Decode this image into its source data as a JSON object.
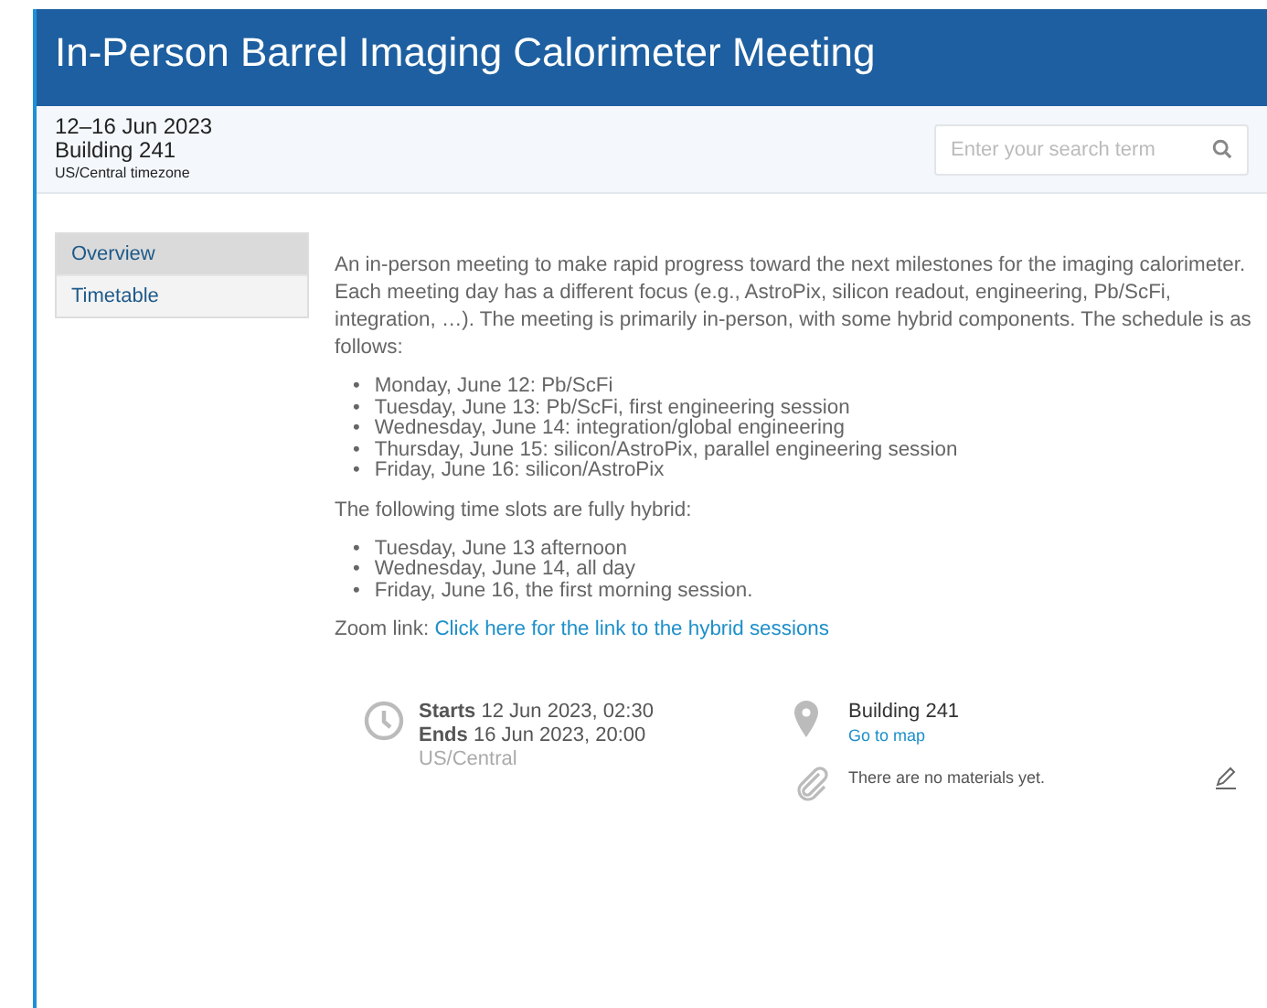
{
  "title": "In-Person Barrel Imaging Calorimeter Meeting",
  "info": {
    "dates": "12–16 Jun 2023",
    "location": "Building 241",
    "timezone": "US/Central timezone"
  },
  "search": {
    "placeholder": "Enter your search term"
  },
  "menu": [
    {
      "label": "Overview",
      "selected": true
    },
    {
      "label": "Timetable",
      "selected": false
    }
  ],
  "description": "An in-person meeting to make rapid progress toward the next milestones for the imaging calorimeter. Each meeting day has a different focus (e.g., AstroPix, silicon readout, engineering, Pb/ScFi, integration, …). The meeting is primarily in-person, with some hybrid components. The schedule is as follows:",
  "schedule": [
    {
      "bullet": "•",
      "text": "Monday, June 12: Pb/ScFi"
    },
    {
      "bullet": "•",
      "text": "Tuesday, June 13: Pb/ScFi, first engineering session"
    },
    {
      "bullet": "•",
      "text": "Wednesday, June 14: integration/global engineering"
    },
    {
      "bullet": "•",
      "text": "Thursday, June 15: silicon/AstroPix, parallel engineering session"
    },
    {
      "bullet": "•",
      "text": "Friday, June 16: silicon/AstroPix"
    }
  ],
  "hybrid_intro": "The following time slots are fully hybrid:",
  "hybrid": [
    {
      "bullet": "•",
      "text": "Tuesday, June 13 afternoon"
    },
    {
      "bullet": "•",
      "text": "Wednesday, June 14, all day"
    },
    {
      "bullet": "•",
      "text": "Friday, June 16, the first morning session."
    }
  ],
  "zoom": {
    "label": "Zoom link:",
    "link": "Click here for the link to the hybrid sessions"
  },
  "when": {
    "starts": "**Starts** 12 Jun 2023, 02:30",
    "ends": "**Ends** 16 Jun 2023, 20:00",
    "timezone": "US/Central"
  },
  "where": {
    "room": "Building 241",
    "map_link": "Go to map"
  },
  "materials": "There are no materials yet."
}
